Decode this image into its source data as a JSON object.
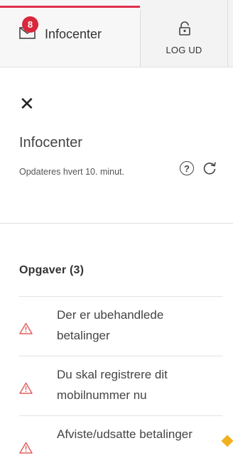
{
  "tabs": {
    "infocenter": {
      "label": "Infocenter",
      "badge_count": "8",
      "icon": "mail-icon"
    },
    "logout": {
      "label": "LOG UD",
      "icon": "lock-icon"
    }
  },
  "panel": {
    "close_icon": "close-icon",
    "title": "Infocenter",
    "subtitle": "Opdateres hvert 10. minut.",
    "help_label": "?",
    "refresh_icon": "refresh-icon"
  },
  "tasks": {
    "heading": "Opgaver (3)",
    "items": [
      {
        "text": "Der er ubehandlede betalinger",
        "icon": "warning-icon"
      },
      {
        "text": "Du skal registrere dit mobilnummer nu",
        "icon": "warning-icon"
      },
      {
        "text": "Afviste/udsatte betalinger",
        "icon": "warning-icon"
      }
    ]
  },
  "colors": {
    "accent": "#e0304d",
    "badge": "#d9273b",
    "warning": "#e06060",
    "marker": "#f2b01e"
  }
}
